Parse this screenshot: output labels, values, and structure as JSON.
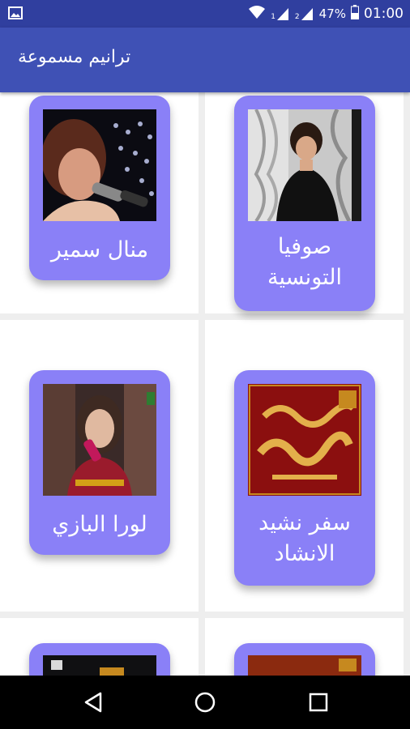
{
  "status_bar": {
    "sim1_label": "1",
    "sim2_label": "2",
    "battery": "47%",
    "time": "01:00",
    "icons": [
      "image-icon",
      "wifi-icon",
      "signal-icon",
      "battery-icon"
    ]
  },
  "app_bar": {
    "title": "ترانيم مسموعة"
  },
  "cards": [
    {
      "label": "صوفيا التونسية",
      "line1": "صوفيا",
      "line2": "التونسية"
    },
    {
      "label": "منال سمير",
      "line1": "منال سمير",
      "line2": ""
    },
    {
      "label": "سفر نشيد الانشاد",
      "line1": "سفر نشيد",
      "line2": "الانشاد"
    },
    {
      "label": "لورا البازي",
      "line1": "لورا البازي",
      "line2": ""
    }
  ],
  "navigation": {
    "icons": [
      "back-icon",
      "home-icon",
      "recents-icon"
    ]
  },
  "colors": {
    "status_bar": "#303f9f",
    "app_bar": "#3f51b5",
    "card": "#8a80f7"
  }
}
